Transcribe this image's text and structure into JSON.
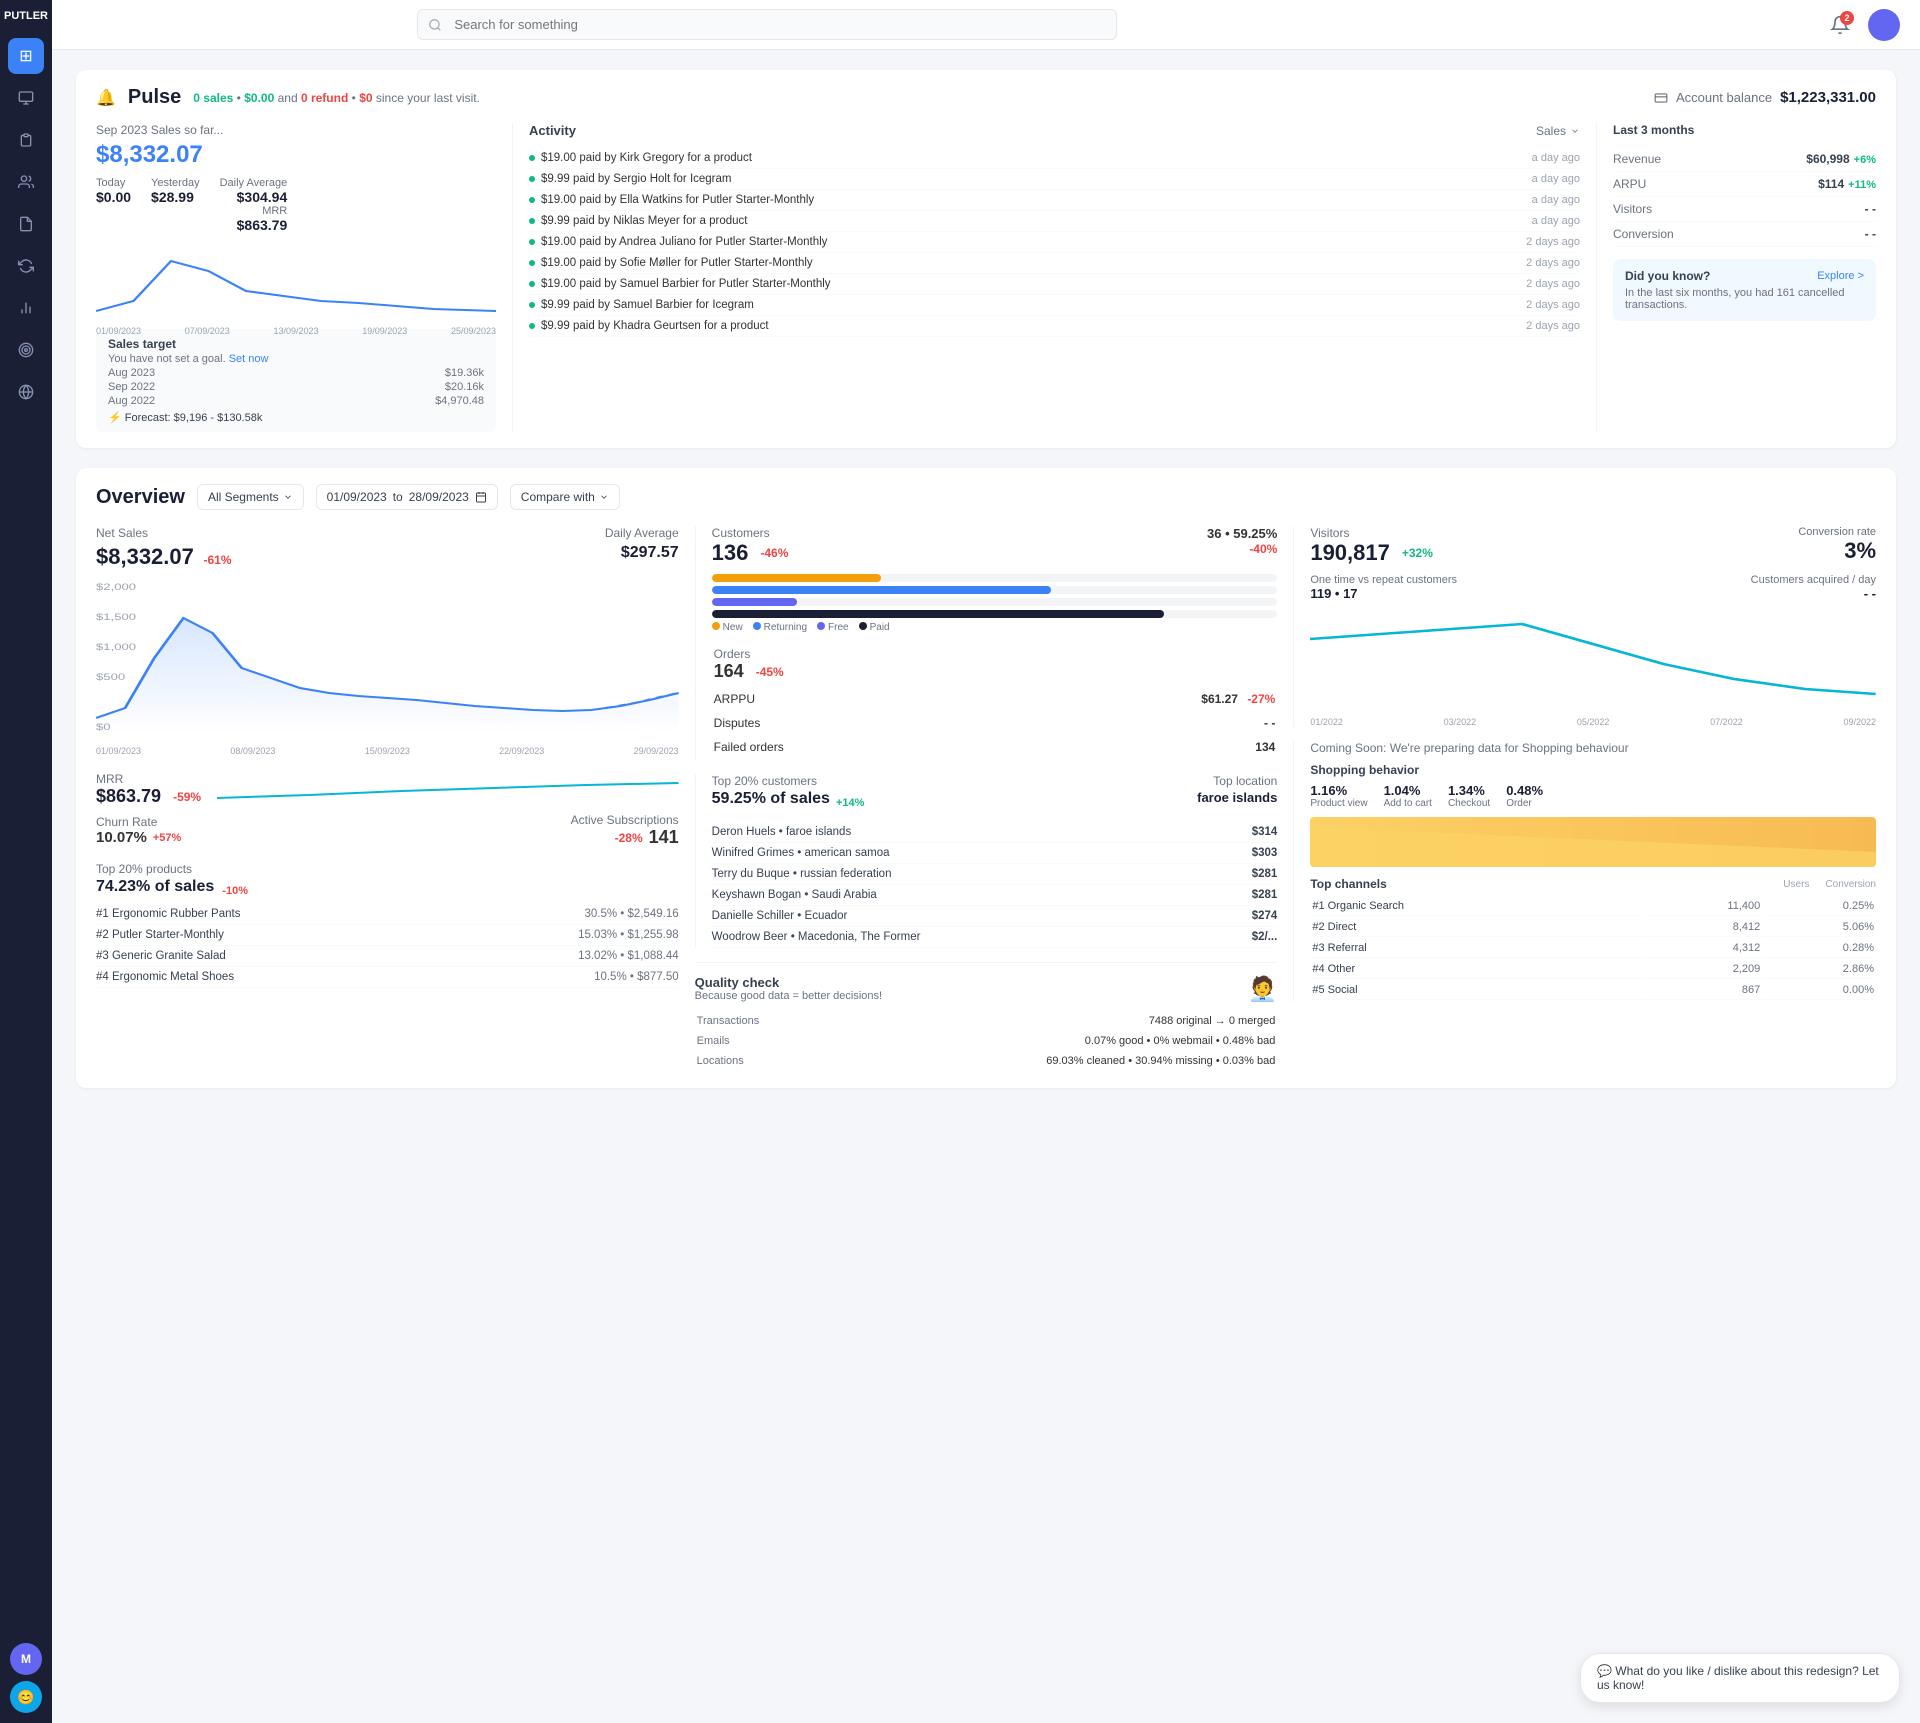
{
  "app": {
    "name": "PUTLER"
  },
  "header": {
    "search_placeholder": "Search for something",
    "notif_count": "2"
  },
  "sidebar": {
    "items": [
      {
        "id": "dashboard",
        "icon": "⊞",
        "active": true
      },
      {
        "id": "revenue",
        "icon": "💰"
      },
      {
        "id": "orders",
        "icon": "📋"
      },
      {
        "id": "customers",
        "icon": "👤"
      },
      {
        "id": "transactions",
        "icon": "📄"
      },
      {
        "id": "subscriptions",
        "icon": "🔄"
      },
      {
        "id": "reports",
        "icon": "📊"
      },
      {
        "id": "goals",
        "icon": "🎯"
      },
      {
        "id": "globe",
        "icon": "🌍"
      }
    ],
    "avatar1_label": "M",
    "avatar2_label": "😊"
  },
  "pulse": {
    "title": "Pulse",
    "meta": {
      "prefix": "",
      "sales": "0 sales",
      "amount": "$0.00",
      "refund_label": "and",
      "refund": "0 refund",
      "refund_amount": "$0",
      "suffix": "since your last visit."
    },
    "account_balance_label": "Account balance",
    "account_balance": "$1,223,331.00",
    "sales_period": "Sep 2023 Sales so far...",
    "sales_amount": "$8,332.07",
    "today_label": "Today",
    "today_value": "$0.00",
    "yesterday_label": "Yesterday",
    "yesterday_value": "$28.99",
    "daily_average_label": "Daily Average",
    "daily_average": "$304.94",
    "mrr_label": "MRR",
    "mrr_value": "$863.79",
    "sales_target_title": "Sales target",
    "sales_target_sub": "You have not set a goal.",
    "set_now_label": "Set now",
    "target_rows": [
      {
        "period": "Aug 2023",
        "value": "$19.36k"
      },
      {
        "period": "Sep 2022",
        "value": "$20.16k"
      },
      {
        "period": "Aug 2022",
        "value": "$4,970.48"
      }
    ],
    "forecast": "Forecast: $9,196 - $130.58k",
    "activity": {
      "title": "Activity",
      "filter": "Sales",
      "items": [
        {
          "text": "$19.00 paid by Kirk Gregory for a product",
          "time": "a day ago"
        },
        {
          "text": "$9.99 paid by Sergio Holt for Icegram",
          "time": "a day ago"
        },
        {
          "text": "$19.00 paid by Ella Watkins for Putler Starter-Monthly",
          "time": "a day ago"
        },
        {
          "text": "$9.99 paid by Niklas Meyer for a product",
          "time": "a day ago"
        },
        {
          "text": "$19.00 paid by Andrea Juliano for Putler Starter-Monthly",
          "time": "2 days ago"
        },
        {
          "text": "$19.00 paid by Sofie Møller for Putler Starter-Monthly",
          "time": "2 days ago"
        },
        {
          "text": "$19.00 paid by Samuel Barbier for Putler Starter-Monthly",
          "time": "2 days ago"
        },
        {
          "text": "$9.99 paid by Samuel Barbier for Icegram",
          "time": "2 days ago"
        },
        {
          "text": "$9.99 paid by Khadra Geurtsen for a product",
          "time": "2 days ago"
        }
      ]
    },
    "last3": {
      "title": "Last 3 months",
      "metrics": [
        {
          "label": "Revenue",
          "value": "$60,998",
          "change": "+6%",
          "positive": true
        },
        {
          "label": "ARPU",
          "value": "$114",
          "change": "+11%",
          "positive": true
        },
        {
          "label": "Visitors",
          "value": "- -",
          "change": "",
          "positive": null
        },
        {
          "label": "Conversion",
          "value": "- -",
          "change": "",
          "positive": null
        }
      ]
    },
    "did_you_know": {
      "title": "Did you know?",
      "explore": "Explore >",
      "text": "In the last six months, you had 161 cancelled transactions."
    }
  },
  "overview": {
    "title": "Overview",
    "segment_label": "All Segments",
    "date_from": "01/09/2023",
    "date_to": "28/09/2023",
    "compare_label": "Compare with",
    "net_sales": {
      "label": "Net Sales",
      "value": "$8,332.07",
      "change": "-61%",
      "daily_avg_label": "Daily Average",
      "daily_avg": "$297.57",
      "chart_labels": [
        "01/09/2023",
        "08/09/2023",
        "15/09/2023",
        "22/09/2023",
        "29/09/2023"
      ]
    },
    "mrr": {
      "label": "MRR",
      "value": "$863.79",
      "change": "-59%"
    },
    "churn": {
      "label": "Churn Rate",
      "value": "10.07%",
      "change": "+57%"
    },
    "active_subs": {
      "label": "Active Subscriptions",
      "change": "-28%",
      "value": "141"
    },
    "top_products": {
      "label": "Top 20% products",
      "pct_label": "74.23% of sales",
      "change": "-10%",
      "items": [
        {
          "rank": "#1",
          "name": "Ergonomic Rubber Pants",
          "pct": "30.5%",
          "amount": "$2,549.16"
        },
        {
          "rank": "#2",
          "name": "Putler Starter-Monthly",
          "pct": "15.03%",
          "amount": "$1,255.98"
        },
        {
          "rank": "#3",
          "name": "Generic Granite Salad",
          "pct": "13.02%",
          "amount": "$1,088.44"
        },
        {
          "rank": "#4",
          "name": "Ergonomic Metal Shoes",
          "pct": "10.5%",
          "amount": "$877.50"
        }
      ]
    },
    "customers": {
      "label": "Customers",
      "value": "136",
      "change": "-46%",
      "bar_value": "36 • 59.25%",
      "bar_change": "-40%",
      "legend": [
        {
          "label": "New",
          "color": "#f59e0b"
        },
        {
          "label": "Returning",
          "color": "#3b82f6"
        },
        {
          "label": "Free",
          "color": "#6366f1"
        },
        {
          "label": "Paid",
          "color": "#1a1f36"
        }
      ],
      "orders": {
        "label": "Orders",
        "value": "164",
        "change": "-45%"
      },
      "arppu_label": "ARPPU",
      "arppu_value": "$61.27",
      "arppu_change": "-27%",
      "disputes_label": "Disputes",
      "disputes_value": "- -",
      "failed_label": "Failed orders",
      "failed_value": "134"
    },
    "top_customers": {
      "label": "Top 20% customers",
      "pct": "59.25% of sales",
      "pct_change": "+14%",
      "top_location_label": "Top location",
      "top_location": "faroe islands",
      "items": [
        {
          "name": "Deron Huels • faroe islands",
          "amount": "$314"
        },
        {
          "name": "Winifred Grimes • american samoa",
          "amount": "$303"
        },
        {
          "name": "Terry du Buque • russian federation",
          "amount": "$281"
        },
        {
          "name": "Keyshawn Bogan • Saudi Arabia",
          "amount": "$281"
        },
        {
          "name": "Danielle Schiller • Ecuador",
          "amount": "$274"
        },
        {
          "name": "Woodrow Beer • Macedonia, The Former",
          "amount": "$2/..."
        }
      ]
    },
    "visitors": {
      "label": "Visitors",
      "value": "190,817",
      "change": "+32%",
      "conv_label": "Conversion rate",
      "conv_value": "3%",
      "one_time_label": "One time vs repeat customers",
      "one_time_value": "119 • 17",
      "acquired_label": "Customers acquired / day",
      "acquired_value": "- -",
      "chart_labels": [
        "01/2022",
        "03/2022",
        "05/2022",
        "07/2022",
        "09/2022"
      ]
    },
    "shopping": {
      "coming_soon": "Coming Soon: We're preparing data for Shopping behaviour",
      "title": "Shopping behavior",
      "stats": [
        {
          "pct": "1.16%",
          "label": "Product view"
        },
        {
          "pct": "1.04%",
          "label": "Add to cart"
        },
        {
          "pct": "1.34%",
          "label": "Checkout"
        },
        {
          "pct": "0.48%",
          "label": "Order"
        }
      ],
      "channels_label": "Top channels",
      "users_col": "Users",
      "conv_col": "Conversion",
      "channels": [
        {
          "rank": "#1",
          "name": "Organic Search",
          "users": "11,400",
          "conv": "0.25%"
        },
        {
          "rank": "#2",
          "name": "Direct",
          "users": "8,412",
          "conv": "5.06%"
        },
        {
          "rank": "#3",
          "name": "Referral",
          "users": "4,312",
          "conv": "0.28%"
        },
        {
          "rank": "#4",
          "name": "Other",
          "users": "2,209",
          "conv": "2.86%"
        },
        {
          "rank": "#5",
          "name": "Social",
          "users": "867",
          "conv": "0.00%"
        }
      ]
    },
    "quality": {
      "title": "Quality check",
      "subtitle": "Because good data = better decisions!",
      "transactions": "7488 original → 0 merged",
      "emails": "0.07% good • 0% webmail • 0.48% bad",
      "locations": "69.03% cleaned • 30.94% missing • 0.03% bad"
    }
  },
  "chat": {
    "text": "What do you like / dislike about this redesign? Let us know!"
  }
}
